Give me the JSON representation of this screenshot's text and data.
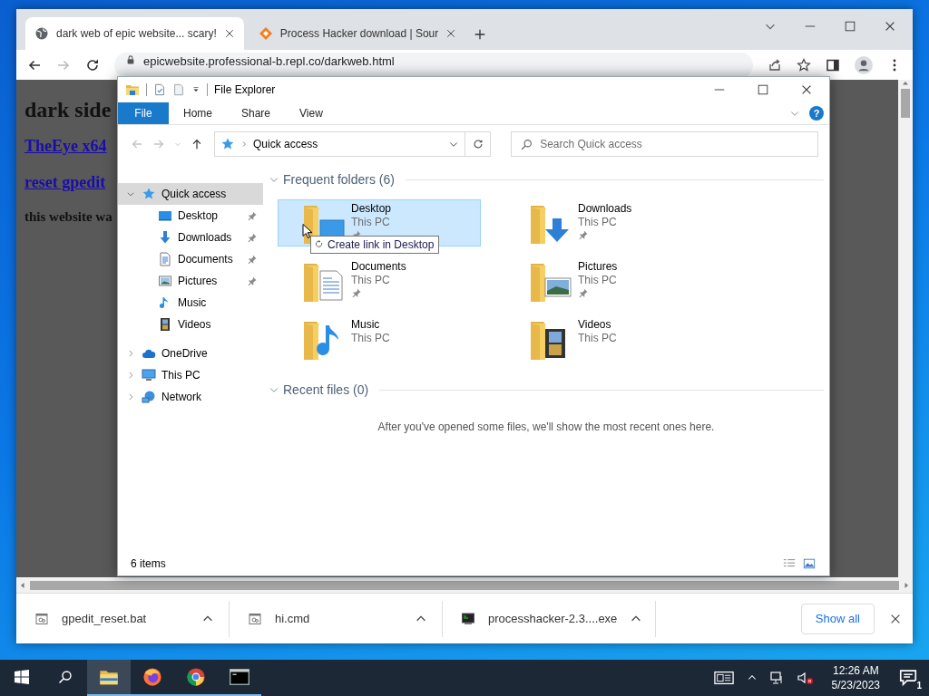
{
  "browser": {
    "tabs": [
      {
        "title": "dark web of epic website... scary!",
        "selected": true,
        "kind": "globe"
      },
      {
        "title": "Process Hacker download | Sour",
        "selected": false,
        "kind": "diamond"
      }
    ],
    "back": {
      "disabled": false
    },
    "forward": {
      "disabled": true
    },
    "address": "epicwebsite.professional-b.repl.co/darkweb.html",
    "page": {
      "heading": "dark side",
      "links": [
        "TheEye x64",
        "reset gpedit"
      ],
      "note": "this website wa"
    },
    "downloads": [
      {
        "name": "gpedit_reset.bat",
        "kind": "script"
      },
      {
        "name": "hi.cmd",
        "kind": "script"
      },
      {
        "name": "processhacker-2.3....exe",
        "kind": "app"
      }
    ],
    "show_all": "Show all"
  },
  "explorer": {
    "title": "File Explorer",
    "ribbon_tabs": [
      {
        "label": "File",
        "selected": true
      },
      {
        "label": "Home",
        "selected": false
      },
      {
        "label": "Share",
        "selected": false
      },
      {
        "label": "View",
        "selected": false
      }
    ],
    "help": "?",
    "back": {
      "disabled": true
    },
    "forward": {
      "disabled": true
    },
    "address": "Quick access",
    "search": {
      "placeholder": "Search Quick access"
    },
    "nav": [
      {
        "label": "Quick access",
        "kind": "star",
        "expanded": true,
        "selected": true,
        "children": [
          {
            "label": "Desktop",
            "kind": "desktop",
            "pinned": true,
            "selected": false
          },
          {
            "label": "Downloads",
            "kind": "downloads",
            "pinned": true,
            "selected": false
          },
          {
            "label": "Documents",
            "kind": "documents",
            "pinned": true,
            "selected": false
          },
          {
            "label": "Pictures",
            "kind": "pictures",
            "pinned": true,
            "selected": false
          },
          {
            "label": "Music",
            "kind": "music",
            "pinned": false,
            "selected": false
          },
          {
            "label": "Videos",
            "kind": "videos",
            "pinned": false,
            "selected": false
          }
        ]
      },
      {
        "label": "OneDrive",
        "kind": "cloud",
        "expanded": false,
        "selected": false
      },
      {
        "label": "This PC",
        "kind": "pc",
        "expanded": false,
        "selected": false
      },
      {
        "label": "Network",
        "kind": "network",
        "expanded": false,
        "selected": false
      }
    ],
    "groups": [
      {
        "title": "Frequent folders (6)",
        "expanded": true,
        "items": [
          {
            "name": "Desktop",
            "location": "This PC",
            "kind": "desktop",
            "pinned": true,
            "selected": true
          },
          {
            "name": "Downloads",
            "location": "This PC",
            "kind": "downloads",
            "pinned": true,
            "selected": false
          },
          {
            "name": "Documents",
            "location": "This PC",
            "kind": "documents",
            "pinned": true,
            "selected": false
          },
          {
            "name": "Pictures",
            "location": "This PC",
            "kind": "pictures",
            "pinned": true,
            "selected": false
          },
          {
            "name": "Music",
            "location": "This PC",
            "kind": "music",
            "pinned": false,
            "selected": false
          },
          {
            "name": "Videos",
            "location": "This PC",
            "kind": "videos",
            "pinned": false,
            "selected": false
          }
        ]
      },
      {
        "title": "Recent files (0)",
        "expanded": true,
        "empty_message": "After you've opened some files, we'll show the most recent ones here."
      }
    ],
    "drag_tooltip": "Create link in Desktop",
    "status": "6 items"
  },
  "taskbar": {
    "apps": [
      {
        "kind": "explorer",
        "active": true
      },
      {
        "kind": "firefox",
        "active": false
      },
      {
        "kind": "chrome",
        "active": false
      },
      {
        "kind": "terminal",
        "active": false
      }
    ],
    "time": "12:26 AM",
    "date": "5/23/2023",
    "notifications": "1"
  }
}
